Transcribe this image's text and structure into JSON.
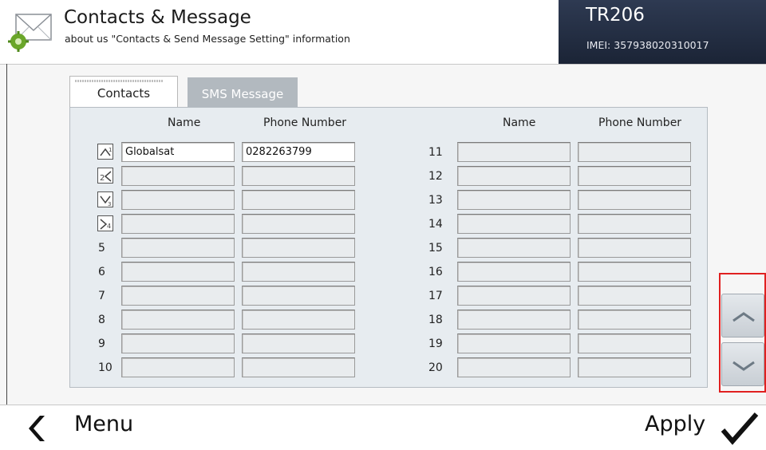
{
  "header": {
    "title": "Contacts & Message",
    "subtitle": "about us \"Contacts & Send Message Setting\" information",
    "icon": "envelope-gear-icon"
  },
  "device": {
    "name": "TR206",
    "imei": "IMEI: 357938020310017"
  },
  "tabs": [
    {
      "label": "Contacts",
      "active": true
    },
    {
      "label": "SMS Message",
      "active": false
    }
  ],
  "columns": {
    "left_name": "Name",
    "left_phone": "Phone Number",
    "right_name": "Name",
    "right_phone": "Phone Number"
  },
  "contacts_left": [
    {
      "label": "1",
      "icon": "quick-key-1-icon",
      "name": "Globalsat",
      "phone": "0282263799"
    },
    {
      "label": "2",
      "icon": "quick-key-2-icon",
      "name": "",
      "phone": ""
    },
    {
      "label": "3",
      "icon": "quick-key-3-icon",
      "name": "",
      "phone": ""
    },
    {
      "label": "4",
      "icon": "quick-key-4-icon",
      "name": "",
      "phone": ""
    },
    {
      "label": "5",
      "name": "",
      "phone": ""
    },
    {
      "label": "6",
      "name": "",
      "phone": ""
    },
    {
      "label": "7",
      "name": "",
      "phone": ""
    },
    {
      "label": "8",
      "name": "",
      "phone": ""
    },
    {
      "label": "9",
      "name": "",
      "phone": ""
    },
    {
      "label": "10",
      "name": "",
      "phone": ""
    }
  ],
  "contacts_right": [
    {
      "label": "11",
      "name": "",
      "phone": ""
    },
    {
      "label": "12",
      "name": "",
      "phone": ""
    },
    {
      "label": "13",
      "name": "",
      "phone": ""
    },
    {
      "label": "14",
      "name": "",
      "phone": ""
    },
    {
      "label": "15",
      "name": "",
      "phone": ""
    },
    {
      "label": "16",
      "name": "",
      "phone": ""
    },
    {
      "label": "17",
      "name": "",
      "phone": ""
    },
    {
      "label": "18",
      "name": "",
      "phone": ""
    },
    {
      "label": "19",
      "name": "",
      "phone": ""
    },
    {
      "label": "20",
      "name": "",
      "phone": ""
    }
  ],
  "scroll": {
    "up_icon": "chevron-up-icon",
    "down_icon": "chevron-down-icon"
  },
  "footer": {
    "menu_label": "Menu",
    "apply_label": "Apply",
    "back_icon": "chevron-left-icon",
    "apply_icon": "checkmark-icon"
  }
}
